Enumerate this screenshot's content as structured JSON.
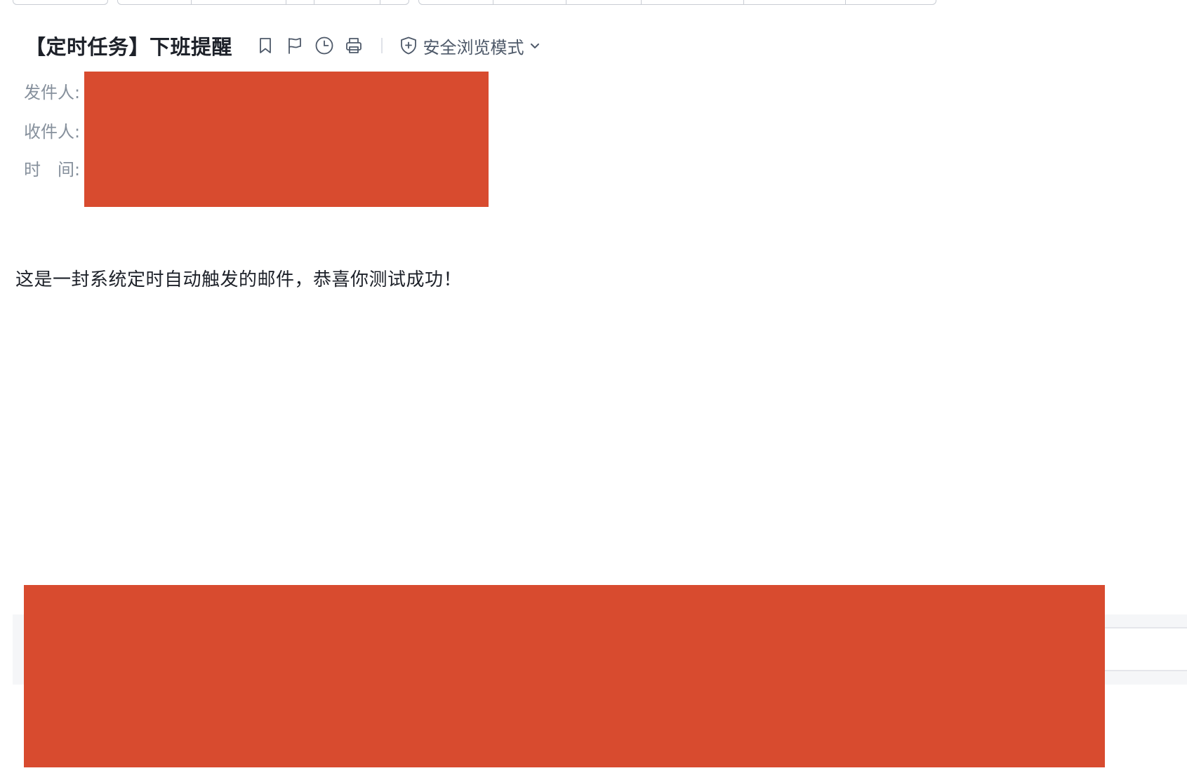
{
  "email": {
    "subject": "【定时任务】下班提醒",
    "safe_browsing_label": "安全浏览模式",
    "fields": {
      "sender_label": "发件人:",
      "recipient_label": "收件人:",
      "time_label": "时　间:"
    },
    "body": "这是一封系统定时自动触发的邮件，恭喜你测试成功！"
  },
  "toolbar_icons": [
    "bookmark-icon",
    "flag-icon",
    "clock-icon",
    "print-icon",
    "shield-plus-icon",
    "chevron-down-icon"
  ],
  "colors": {
    "redaction": "#d84b2f",
    "title_text": "#1d2129",
    "label_text": "#86909c",
    "icon": "#4e5969"
  }
}
